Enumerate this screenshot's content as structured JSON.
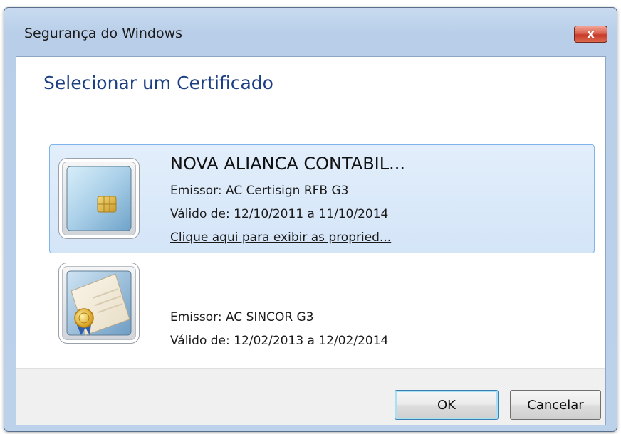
{
  "window": {
    "title": "Segurança do Windows",
    "close_label": "x"
  },
  "heading": "Selecionar um Certificado",
  "certificates": [
    {
      "name": "NOVA ALIANCA CONTABIL...",
      "issuer": "Emissor: AC Certisign RFB G3",
      "validity": "Válido de: 12/10/2011 a 11/10/2014",
      "link": "Clique aqui para exibir as propried...",
      "icon": "smartcard-icon",
      "selected": true
    },
    {
      "name": "",
      "issuer": "Emissor: AC SINCOR G3",
      "validity": "Válido de: 12/02/2013 a 12/02/2014",
      "icon": "certificate-icon",
      "selected": false
    }
  ],
  "buttons": {
    "ok": "OK",
    "cancel": "Cancelar"
  },
  "colors": {
    "accent": "#1b3f82",
    "selection_bg": "#d9e8f9",
    "selection_border": "#7eb4ea",
    "close_red": "#c8392a"
  }
}
